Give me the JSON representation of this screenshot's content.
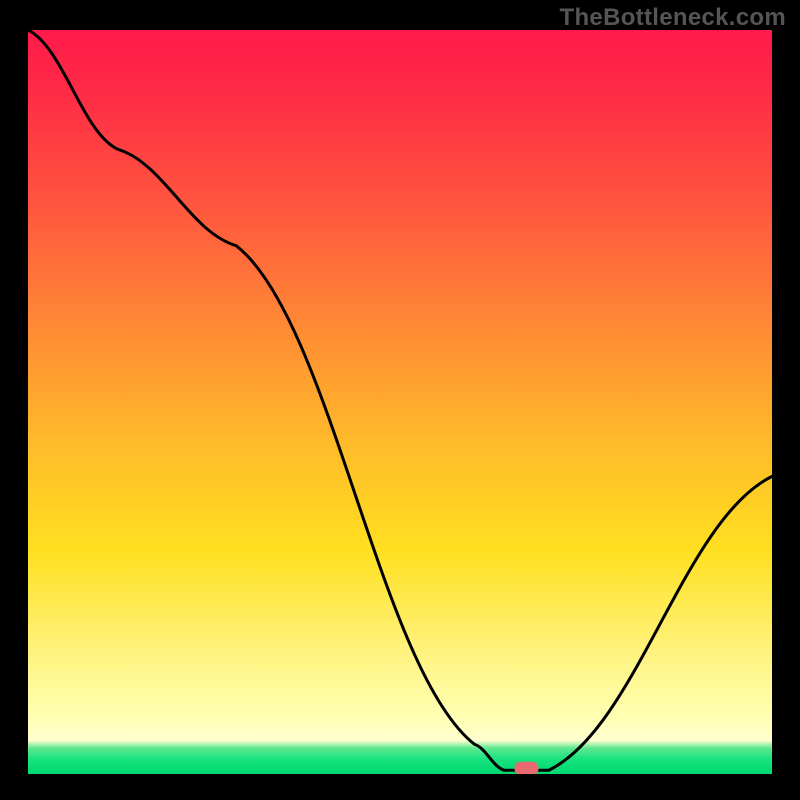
{
  "watermark": "TheBottleneck.com",
  "chart_data": {
    "type": "line",
    "title": "",
    "xlabel": "",
    "ylabel": "",
    "xlim": [
      0,
      100
    ],
    "ylim": [
      0,
      100
    ],
    "x": [
      0,
      12,
      28,
      60,
      64,
      70,
      100
    ],
    "values": [
      100,
      84,
      71,
      4,
      0.5,
      0.5,
      40
    ],
    "marker": {
      "x": 67,
      "y": 0.7,
      "color": "#e86a6f"
    },
    "background": {
      "colors": [
        "#ff1a4b",
        "#ffb92a",
        "#fff27a",
        "#18e37e"
      ],
      "orientation": "vertical"
    }
  }
}
